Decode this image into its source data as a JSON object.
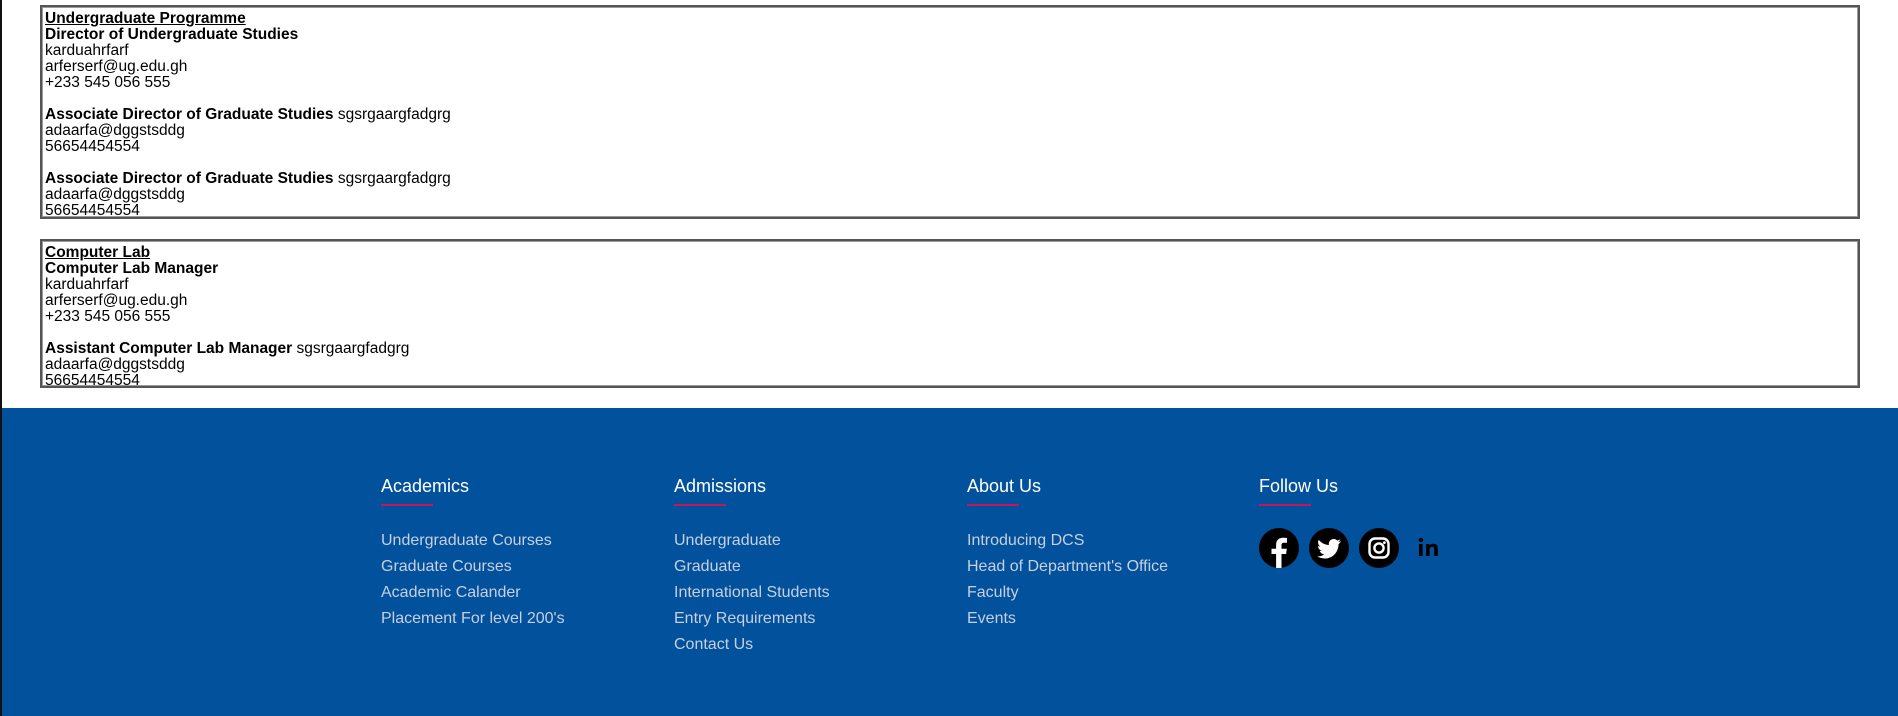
{
  "contacts": {
    "undergrad": {
      "title": "Undergraduate Programme",
      "people": [
        {
          "role": "Director of Undergraduate Studies",
          "name": "karduahrfarf",
          "email": "arferserf@ug.edu.gh",
          "phone": "+233 545 056 555"
        },
        {
          "role": "Associate Director of Graduate Studies",
          "name": "sgsrgaargfadgrg",
          "email": "adaarfa@dggstsddg",
          "phone": "56654454554"
        },
        {
          "role": "Associate Director of Graduate Studies",
          "name": "sgsrgaargfadgrg",
          "email": "adaarfa@dggstsddg",
          "phone": "56654454554"
        }
      ]
    },
    "lab": {
      "title": "Computer Lab",
      "people": [
        {
          "role": "Computer Lab Manager",
          "name": "karduahrfarf",
          "email": "arferserf@ug.edu.gh",
          "phone": "+233 545 056 555"
        },
        {
          "role": "Assistant Computer Lab Manager",
          "name": "sgsrgaargfadgrg",
          "email": "adaarfa@dggstsddg",
          "phone": "56654454554"
        }
      ]
    }
  },
  "footer": {
    "academics": {
      "heading": "Academics",
      "links": [
        "Undergraduate Courses",
        "Graduate Courses",
        "Academic Calander",
        "Placement For level 200's"
      ]
    },
    "admissions": {
      "heading": "Admissions",
      "links": [
        "Undergraduate",
        "Graduate",
        "International Students",
        "Entry Requirements",
        "Contact Us"
      ]
    },
    "about": {
      "heading": "About Us",
      "links": [
        "Introducing DCS",
        "Head of Department's Office",
        "Faculty",
        "Events"
      ]
    },
    "follow": {
      "heading": "Follow Us",
      "icons": [
        "facebook-icon",
        "twitter-icon",
        "instagram-icon",
        "linkedin-icon"
      ]
    },
    "colors": {
      "background": "#02519c",
      "accent": "#c2185b",
      "link": "#c7cfe0"
    }
  }
}
